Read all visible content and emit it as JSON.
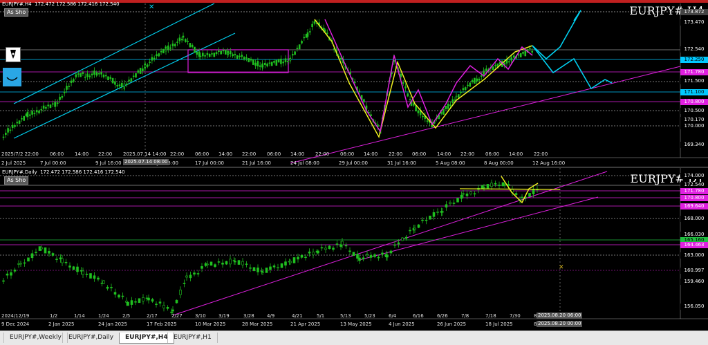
{
  "h4": {
    "header": "EURJPY#,H4  172.472 172.586 172.416 172.540",
    "as_button": "As Sho",
    "title": "EURJPY#  H4",
    "price_labels": [
      {
        "text": "173.872",
        "color": "#ffffff",
        "bg": "#444444"
      },
      {
        "text": "173.470",
        "color": "#ffffff",
        "bg": "#000000"
      },
      {
        "text": "172.540",
        "color": "#ffffff",
        "bg": "#000000"
      },
      {
        "text": "172.250",
        "color": "#000000",
        "bg": "#00c8ff"
      },
      {
        "text": "171.780",
        "color": "#ffffff",
        "bg": "#e020e0"
      },
      {
        "text": "171.500",
        "color": "#ffffff",
        "bg": "#000000"
      },
      {
        "text": "171.100",
        "color": "#000000",
        "bg": "#00c8ff"
      },
      {
        "text": "170.800",
        "color": "#ffffff",
        "bg": "#e020e0"
      },
      {
        "text": "170.500",
        "color": "#ffffff",
        "bg": "#000000"
      },
      {
        "text": "170.170",
        "color": "#ffffff",
        "bg": "#000000"
      },
      {
        "text": "170.000",
        "color": "#ffffff",
        "bg": "#000000"
      },
      {
        "text": "169.340",
        "color": "#ffffff",
        "bg": "#000000"
      }
    ],
    "time_labels": [
      "2 Jul 2025",
      "7 Jul 00:00",
      "9 Jul 16:00",
      "14 Jul 08:00",
      "17 Jul 00:00",
      "21 Jul 16:00",
      "24 Jul 08:00",
      "29 Jul 00:00",
      "31 Jul 16:00",
      "5 Aug 08:00",
      "8 Aug 00:00",
      "12 Aug 16:00"
    ],
    "intraday_labels": [
      "2025/7/2 22:00",
      "06:00",
      "14:00",
      "22:00",
      "2025.07.14 14:00",
      "22:00",
      "06:00",
      "14:00",
      "22:00",
      "06:00",
      "14:00",
      "22:00",
      "06:00",
      "14:00",
      "22:00",
      "06:00",
      "14:00",
      "22:00",
      "06:00",
      "14:00",
      "22:00"
    ],
    "crosshair_time": "2025.07.14 08:00"
  },
  "d1": {
    "header": "EURJPY#,Daily  172.472 172.586 172.416 172.540",
    "as_button": "As Sho",
    "title": "EURJPY#  D1",
    "price_labels": [
      {
        "text": "174.000",
        "color": "#ffffff",
        "bg": "#000000"
      },
      {
        "text": "172.540",
        "color": "#ffffff",
        "bg": "#000000"
      },
      {
        "text": "171.780",
        "color": "#ffffff",
        "bg": "#e020e0"
      },
      {
        "text": "170.800",
        "color": "#ffffff",
        "bg": "#e020e0"
      },
      {
        "text": "169.640",
        "color": "#ffffff",
        "bg": "#e020e0"
      },
      {
        "text": "168.000",
        "color": "#ffffff",
        "bg": "#000000"
      },
      {
        "text": "166.030",
        "color": "#ffffff",
        "bg": "#000000"
      },
      {
        "text": "165.160",
        "color": "#000000",
        "bg": "#20c040"
      },
      {
        "text": "164.463",
        "color": "#ffffff",
        "bg": "#e020e0"
      },
      {
        "text": "163.000",
        "color": "#ffffff",
        "bg": "#000000"
      },
      {
        "text": "160.997",
        "color": "#ffffff",
        "bg": "#000000"
      },
      {
        "text": "159.460",
        "color": "#ffffff",
        "bg": "#000000"
      },
      {
        "text": "156.050",
        "color": "#ffffff",
        "bg": "#000000"
      }
    ],
    "time_labels": [
      "9 Dec 2024",
      "2 Jan 2025",
      "24 Jan 2025",
      "17 Feb 2025",
      "10 Mar 2025",
      "28 Mar 2025",
      "21 Apr 2025",
      "13 May 2025",
      "4 Jun 2025",
      "26 Jun 2025",
      "18 Jul 2025",
      "8/"
    ],
    "date_labels": [
      "2024/12/19",
      "1/2",
      "1/14",
      "1/24",
      "2/5",
      "2/17",
      "2/27",
      "3/10",
      "3/19",
      "3/28",
      "4/9",
      "4/21",
      "5/1",
      "5/13",
      "5/23",
      "6/4",
      "6/16",
      "6/26",
      "7/8",
      "7/18",
      "7/30",
      "8/"
    ],
    "crosshair_time": "2025.08.20 06:00",
    "crosshair_time2": "2025.08.20 00:00"
  },
  "tabs": [
    {
      "label": "EURJPY#,Weekly",
      "active": false
    },
    {
      "label": "EURJPY#,Daily",
      "active": false
    },
    {
      "label": "EURJPY#,H4",
      "active": true
    },
    {
      "label": "EURJPY#,H1",
      "active": false
    }
  ],
  "icons": [
    "pen-tool-icon",
    "object-list-icon"
  ],
  "colors": {
    "cyan": "#00d0f0",
    "magenta": "#e020e0",
    "yellow": "#f0f020",
    "candle": "#20c020",
    "grid": "#666666"
  }
}
